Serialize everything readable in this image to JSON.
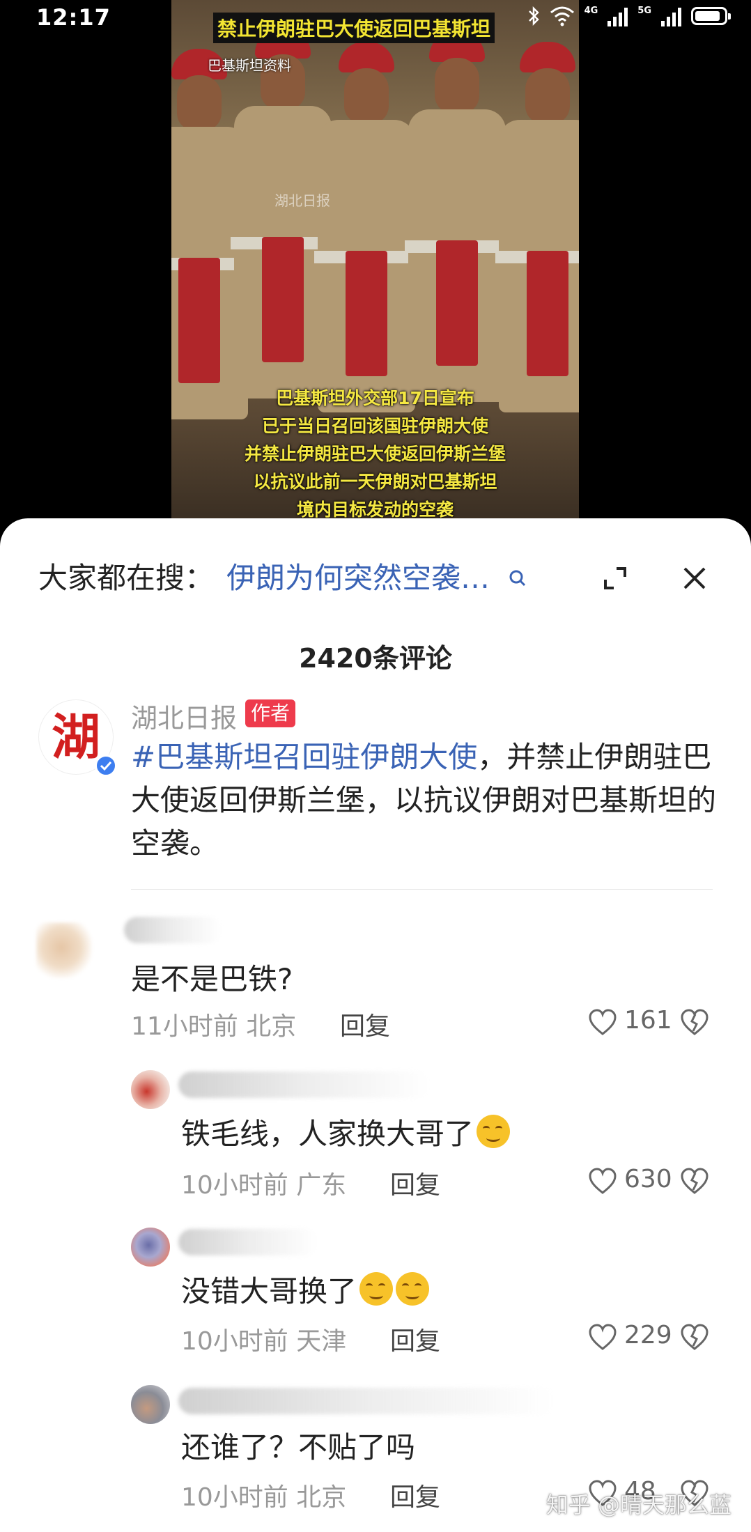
{
  "status_bar": {
    "time": "12:17",
    "signal_1_label": "4G",
    "signal_2_label": "5G"
  },
  "video": {
    "title": "禁止伊朗驻巴大使返回巴基斯坦",
    "source": "巴基斯坦资料",
    "watermark": "湖北日报",
    "caption_lines": [
      "巴基斯坦外交部17日宣布",
      "已于当日召回该国驻伊朗大使",
      "并禁止伊朗驻巴大使返回伊斯兰堡",
      "以抗议此前一天伊朗对巴基斯坦",
      "境内目标发动的空袭"
    ]
  },
  "search": {
    "prefix": "大家都在搜：",
    "term": "伊朗为何突然空袭…",
    "icon": "search-icon"
  },
  "header": {
    "comment_count": "2420条评论",
    "expand_icon": "expand-icon",
    "close_icon": "close-icon"
  },
  "main_post": {
    "avatar_glyph": "湖",
    "author": "湖北日报",
    "badge": "作者",
    "hashtag": "#巴基斯坦召回驻伊朗大使",
    "text_rest": "，并禁止伊朗驻巴大使返回伊斯兰堡，以抗议伊朗对巴基斯坦的空袭。"
  },
  "comments": [
    {
      "text": "是不是巴铁?",
      "time": "11小时前",
      "location": "北京",
      "reply": "回复",
      "likes": "161"
    },
    {
      "text": "铁毛线，人家换大哥了",
      "time": "10小时前",
      "location": "广东",
      "reply": "回复",
      "likes": "630"
    },
    {
      "text": "没错大哥换了",
      "time": "10小时前",
      "location": "天津",
      "reply": "回复",
      "likes": "229"
    },
    {
      "text": "还谁了？不贴了吗",
      "time": "10小时前",
      "location": "北京",
      "reply": "回复",
      "likes": "48"
    }
  ],
  "footer_watermark": "知乎 @晴天那么蓝",
  "colors": {
    "link_blue": "#3a63b5",
    "badge_red": "#ee3b4c",
    "caption_yellow": "#f5e842",
    "verified_blue": "#3d7ef0"
  }
}
